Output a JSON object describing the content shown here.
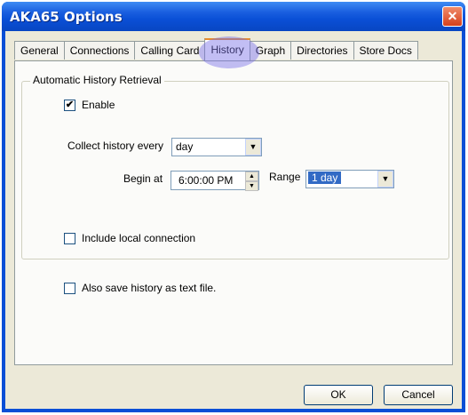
{
  "window": {
    "title": "AKA65 Options",
    "close_glyph": "✕"
  },
  "tabs": [
    {
      "label": "General"
    },
    {
      "label": "Connections"
    },
    {
      "label": "Calling Card"
    },
    {
      "label": "History"
    },
    {
      "label": "Graph"
    },
    {
      "label": "Directories"
    },
    {
      "label": "Store Docs"
    }
  ],
  "active_tab": "History",
  "group": {
    "title": "Automatic History Retrieval"
  },
  "enable": {
    "label": "Enable",
    "checked": true,
    "mark": "✔"
  },
  "collect": {
    "label": "Collect history every",
    "value": "day"
  },
  "begin": {
    "label": "Begin at",
    "value": "6:00:00 PM"
  },
  "range": {
    "label": "Range",
    "value": "1 day"
  },
  "include_local": {
    "label": "Include local connection",
    "checked": false
  },
  "save_text": {
    "label": "Also save history as text file.",
    "checked": false
  },
  "buttons": {
    "ok": "OK",
    "cancel": "Cancel"
  },
  "colors": {
    "titlebar": "#0a4fd6",
    "client": "#ece9d8",
    "highlight_ellipse": "#786ee6"
  }
}
